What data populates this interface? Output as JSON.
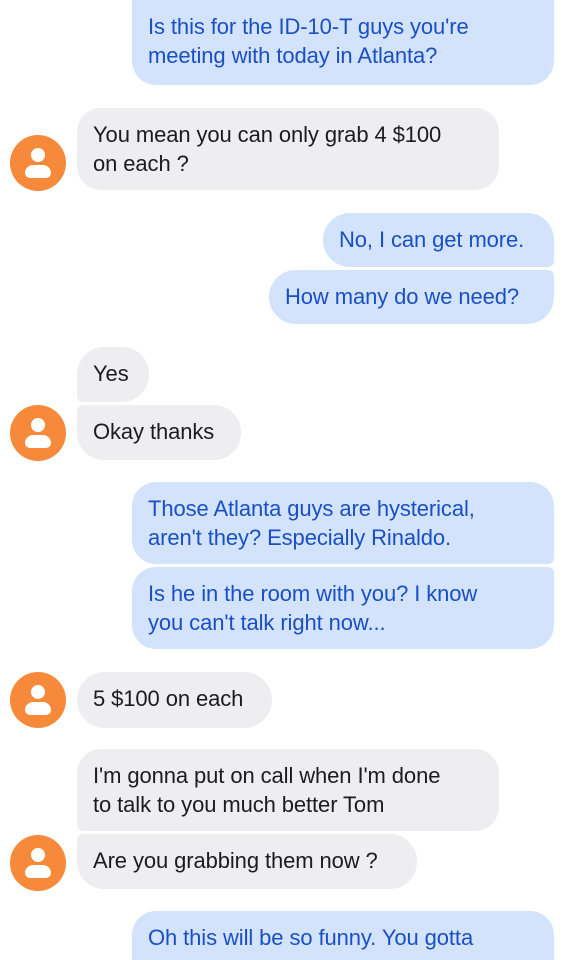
{
  "conversation": {
    "messages": [
      {
        "direction": "outgoing",
        "text": "Is this for the ID-10-T guys you're\nmeeting with today in Atlanta?"
      },
      {
        "direction": "incoming",
        "text": "You mean you can only grab 4 $100\non each ?"
      },
      {
        "direction": "outgoing",
        "text": "No, I can get more."
      },
      {
        "direction": "outgoing",
        "text": "How many do we need?"
      },
      {
        "direction": "incoming",
        "text": "Yes"
      },
      {
        "direction": "incoming",
        "text": "Okay thanks"
      },
      {
        "direction": "outgoing",
        "text": "Those Atlanta guys are hysterical,\naren't they?  Especially Rinaldo."
      },
      {
        "direction": "outgoing",
        "text": "Is he in the room with you?  I know\nyou can't talk right now..."
      },
      {
        "direction": "incoming",
        "text": "5 $100 on each"
      },
      {
        "direction": "incoming",
        "text": "I'm gonna put on call when I'm done\nto talk to you much better Tom"
      },
      {
        "direction": "incoming",
        "text": "Are you grabbing them now ?"
      },
      {
        "direction": "outgoing",
        "text": "Oh this will be so funny.  You gotta"
      }
    ],
    "colors": {
      "outgoing_bubble": "#d3e3fb",
      "outgoing_text": "#1a4fc4",
      "incoming_bubble": "#eeeef1",
      "incoming_text": "#1c1c1e",
      "avatar": "#f7893a"
    },
    "avatar_icon": "person-icon"
  }
}
